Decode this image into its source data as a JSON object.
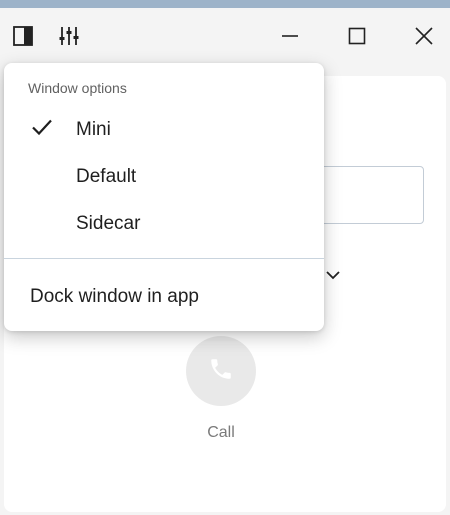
{
  "titlebar": {
    "sidebar_icon": "sidebar-panel-icon",
    "settings_icon": "sliders-icon",
    "minimize_icon": "minimize-icon",
    "maximize_icon": "maximize-icon",
    "close_icon": "close-icon"
  },
  "menu": {
    "header": "Window options",
    "items": [
      {
        "label": "Mini",
        "checked": true
      },
      {
        "label": "Default",
        "checked": false
      },
      {
        "label": "Sidecar",
        "checked": false
      }
    ],
    "dock_label": "Dock window in app"
  },
  "main": {
    "call_label": "Call",
    "call_icon": "phone-icon"
  },
  "colors": {
    "accent_stripe": "#9db3c9",
    "call_circle": "#e9e9e9"
  }
}
